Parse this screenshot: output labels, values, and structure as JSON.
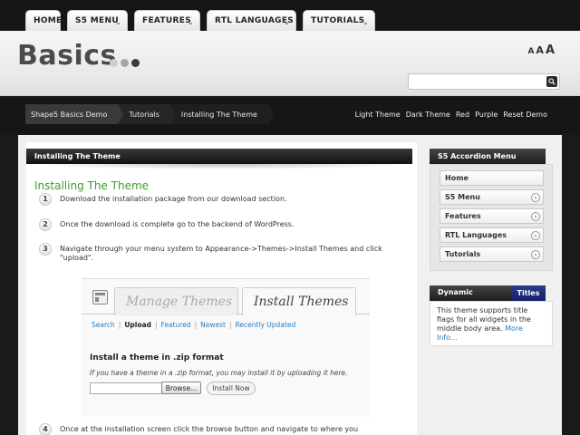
{
  "nav": {
    "tabs": [
      {
        "label": "HOME",
        "chevron": false
      },
      {
        "label": "S5 MENU",
        "chevron": true
      },
      {
        "label": "FEATURES",
        "chevron": true
      },
      {
        "label": "RTL LANGUAGES",
        "chevron": true
      },
      {
        "label": "TUTORIALS",
        "chevron": true
      }
    ]
  },
  "header": {
    "logo": "Basics",
    "logo_dot_colors": [
      "#cfcfcf",
      "#a5a5a5",
      "#3c3c3c"
    ],
    "font_sizer": [
      "A",
      "A",
      "A"
    ],
    "search": {
      "value": "",
      "placeholder": ""
    }
  },
  "breadcrumb": [
    "Shape5 Basics Demo",
    "Tutorials",
    "Installing The Theme"
  ],
  "theme_links": [
    "Light Theme",
    "Dark Theme",
    "Red",
    "Purple",
    "Reset Demo"
  ],
  "main": {
    "title_bar": "Installing The Theme",
    "heading": "Installing The Theme",
    "heading_color": "#3e9a2a",
    "steps": [
      {
        "num": "1",
        "text": "Download the installation package from our download section."
      },
      {
        "num": "2",
        "text": "Once the download is complete go to the backend of WordPress."
      },
      {
        "num": "3",
        "text": "Navigate through your menu system to Appearance->Themes->Install Themes and click \"upload\"."
      },
      {
        "num": "4",
        "text": "Once at the installation screen click the browse button and navigate to where you downloaded the template file."
      }
    ],
    "wp_screen": {
      "tab_inactive": "Manage Themes",
      "tab_active": "Install Themes",
      "links": [
        "Search",
        "Upload",
        "Featured",
        "Newest",
        "Recently Updated"
      ],
      "current_link": "Upload",
      "heading": "Install a theme in .zip format",
      "description": "If you have a theme in a .zip format, you may install it by uploading it here.",
      "browse_label": "Browse...",
      "install_label": "Install Now"
    }
  },
  "sidebar": {
    "accordion_title": "S5 Accordion Menu",
    "accordion_items": [
      {
        "label": "Home",
        "arrow": false
      },
      {
        "label": "S5 Menu",
        "arrow": true
      },
      {
        "label": "Features",
        "arrow": true
      },
      {
        "label": "RTL Languages",
        "arrow": true
      },
      {
        "label": "Tutorials",
        "arrow": true
      }
    ],
    "dynamic_title_left": "Dynamic",
    "dynamic_title_right": "Titles",
    "dynamic_text": "This theme supports title flags for all widgets in the middle body area.",
    "dynamic_more": "More Info..."
  }
}
